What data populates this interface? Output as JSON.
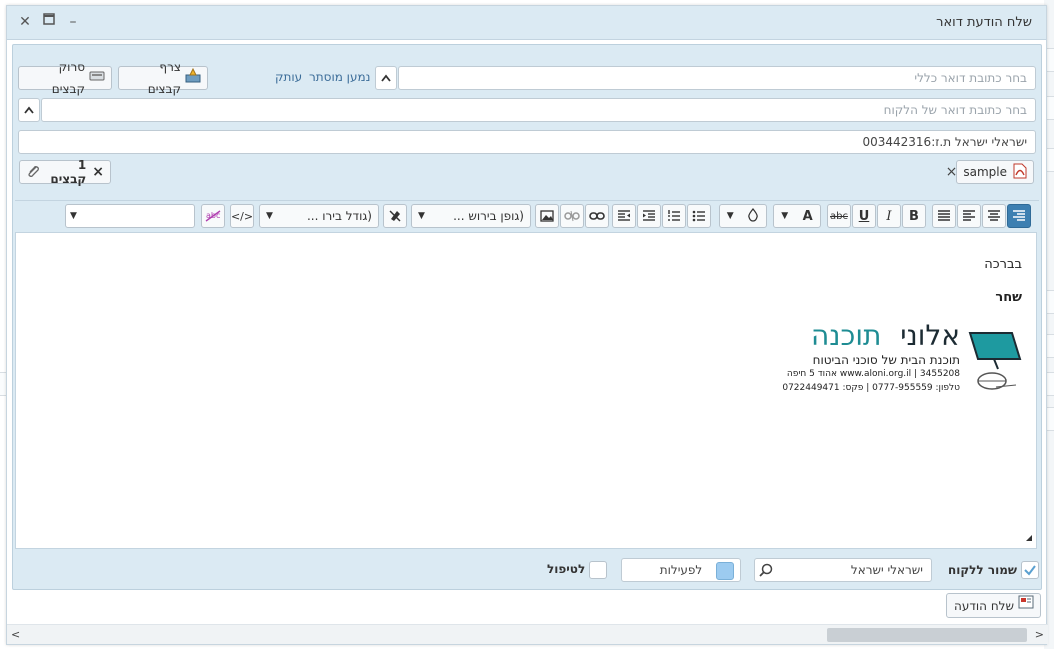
{
  "window": {
    "title": "שלח הודעת דואר",
    "close_glyph": "✕",
    "maximize_glyph": "▭",
    "minimize_glyph": "–"
  },
  "recipients": {
    "general_placeholder": "בחר כתובת דואר כללי",
    "customer_placeholder": "בחר כתובת דואר של הלקוח",
    "subject_value": "ישראלי ישראל  ת.ז:003442316",
    "hidden_recipient_link": "נמען מוסתר",
    "copy_link": "עותק",
    "caret_glyph": "^"
  },
  "buttons": {
    "attach_files": "צרף קבצים",
    "scan_files": "סרוק קבצים"
  },
  "attachments": {
    "sample_name": "sample",
    "files_count_label": "1 קבצים",
    "remove_glyph": "×"
  },
  "toolbar": {
    "font_family": "(גופן בירוש ...",
    "font_size": "(גודל בירו ...",
    "text_color_letter": "A",
    "bold": "B",
    "italic": "I",
    "underline": "U",
    "strike": "abc",
    "source_glyph": "</>",
    "dropdown_glyph": "▼"
  },
  "editor": {
    "greeting": "בברכה",
    "signer": "שחר",
    "logo_name_dark": "אלוני",
    "logo_name_teal": "תוכנה",
    "logo_tagline": "תוכנת הבית של סוכני הביטוח",
    "logo_address": "www.aloni.org.il  |  3455208 אהוד 5 חיפה",
    "logo_phone": "טלפון: 0777-955559  |  פקס: 0722449471"
  },
  "footer": {
    "save_to_customer": "שמור ללקוח",
    "customer_search_value": "ישראלי ישראל",
    "activities_label": "לפעילות",
    "treatment_label": "לטיפול"
  },
  "send": {
    "send_button": "שלח הודעה"
  },
  "colors": {
    "accent": "#3d7fb1",
    "panel": "#dbeaf3",
    "logo_teal": "#1e8c93"
  }
}
